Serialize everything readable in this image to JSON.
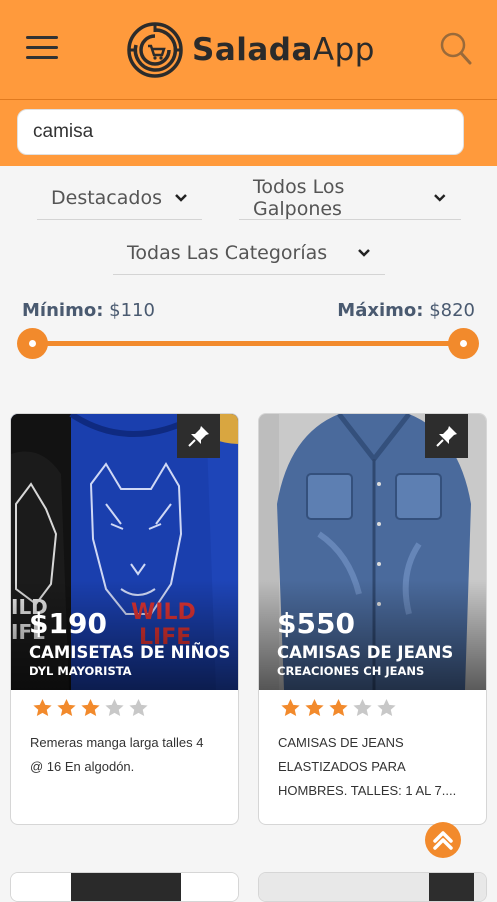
{
  "header": {
    "brand_bold": "Salada",
    "brand_light": "App"
  },
  "search": {
    "value": "camisa"
  },
  "filters": {
    "sort": "Destacados",
    "galpones": "Todos Los Galpones",
    "categorias": "Todas Las Categorías"
  },
  "price_range": {
    "min_label": "Mínimo:",
    "min_value": "$110",
    "max_label": "Máximo:",
    "max_value": "$820"
  },
  "products": [
    {
      "price": "$190",
      "title": "CAMISETAS DE NIÑOS",
      "seller": "DYL MAYORISTA",
      "rating": 3,
      "max_rating": 5,
      "description": "Remeras manga larga talles 4 @ 16 En algodón."
    },
    {
      "price": "$550",
      "title": "CAMISAS DE JEANS",
      "seller": "CREACIONES CH JEANS",
      "rating": 3,
      "max_rating": 5,
      "description": "CAMISAS DE JEANS ELASTIZADOS PARA HOMBRES. TALLES: 1 AL 7...."
    }
  ],
  "colors": {
    "accent": "#ff9a3c",
    "slider": "#f28a2c",
    "star_on": "#f28a2c",
    "star_off": "#c8c8c8"
  }
}
